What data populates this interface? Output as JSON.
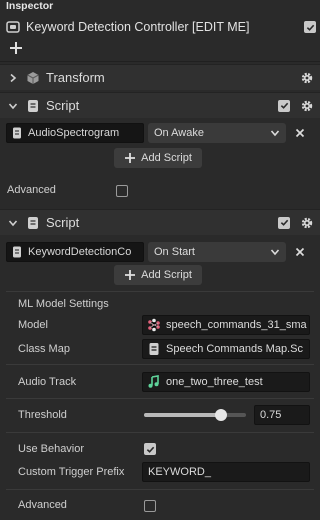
{
  "inspector": {
    "title": "Inspector",
    "object_name": "Keyword Detection Controller [EDIT ME]",
    "object_enabled": true
  },
  "transform": {
    "title": "Transform"
  },
  "script1": {
    "title": "Script",
    "enabled": true,
    "script_name": "AudioSpectrogram",
    "event": "On Awake",
    "add_script_label": "Add Script",
    "advanced_label": "Advanced",
    "advanced_checked": false
  },
  "script2": {
    "title": "Script",
    "enabled": true,
    "script_name": "KeywordDetectionCo",
    "event": "On Start",
    "add_script_label": "Add Script",
    "ml_settings_label": "ML Model Settings",
    "model_label": "Model",
    "model_value": "speech_commands_31_sma",
    "classmap_label": "Class Map",
    "classmap_value": "Speech Commands Map.Sc",
    "audio_track_label": "Audio Track",
    "audio_track_value": "one_two_three_test",
    "threshold_label": "Threshold",
    "threshold_value": "0.75",
    "threshold_fraction": 0.75,
    "use_behavior_label": "Use Behavior",
    "use_behavior_checked": true,
    "trigger_prefix_label": "Custom Trigger Prefix",
    "trigger_prefix_value": "KEYWORD_",
    "advanced_label": "Advanced",
    "advanced_checked": false
  },
  "colors": {
    "audio_icon": "#5fd39a",
    "model_icon": "#e0607a",
    "background": "#2a2a2a"
  },
  "icons": {
    "object": "object-icon",
    "transform": "transform-icon",
    "script": "script-icon",
    "gear": "gear-icon",
    "close": "close-icon",
    "model": "model-icon",
    "audio": "audio-icon"
  }
}
